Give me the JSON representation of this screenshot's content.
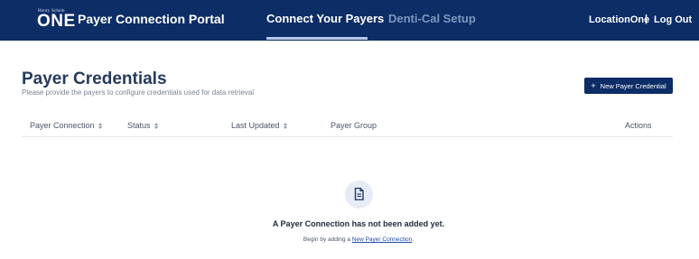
{
  "header": {
    "brand_small": "Henry Schein",
    "brand_mark": "ONE",
    "app_title": "Payer Connection Portal",
    "tabs": [
      {
        "label": "Connect Your Payers",
        "active": true
      },
      {
        "label": "Denti-Cal Setup",
        "active": false
      }
    ],
    "location": "LocationOne",
    "separator": "|",
    "logout_label": "Log Out"
  },
  "page": {
    "title": "Payer Credentials",
    "subtitle": "Please provide the payers to configure credentials used for data retrieval",
    "new_button_icon": "+",
    "new_button_label": "New Payer Credential"
  },
  "table": {
    "columns": [
      {
        "label": "Payer Connection",
        "sortable": true
      },
      {
        "label": "Status",
        "sortable": true
      },
      {
        "label": "Last Updated",
        "sortable": true
      },
      {
        "label": "Payer Group",
        "sortable": false
      },
      {
        "label": "Actions",
        "sortable": false
      }
    ],
    "rows": []
  },
  "empty_state": {
    "icon": "document-icon",
    "title": "A Payer Connection has not been added yet.",
    "hint_prefix": "Begin by adding a ",
    "hint_link": "New Payer Connection",
    "hint_suffix": "."
  },
  "colors": {
    "nav_background": "#0c2d66",
    "inactive_tab": "#7f97c0",
    "link": "#1b4aa8"
  }
}
